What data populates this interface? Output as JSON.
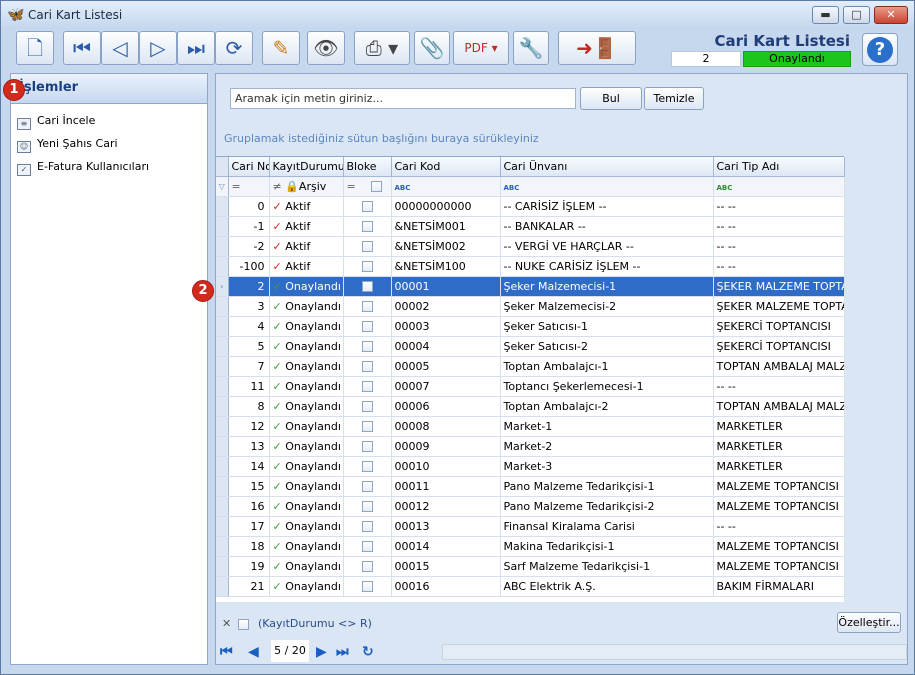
{
  "window": {
    "title": "Cari Kart Listesi",
    "min_label": "▬",
    "max_label": "□",
    "close_label": "✕"
  },
  "header": {
    "title": "Cari Kart Listesi",
    "record_no": "2",
    "status": "Onaylandı",
    "help_label": "?"
  },
  "toolbar": {
    "icons": [
      "new-doc-icon",
      "first-icon",
      "prev-icon",
      "next-icon",
      "last-icon",
      "refresh-icon",
      "edit-icon",
      "preview-icon",
      "print-icon",
      "attach-icon",
      "pdf-save-icon",
      "settings-icon",
      "exit-icon"
    ]
  },
  "left_panel": {
    "title": "İşlemler",
    "items": [
      {
        "label": "Cari İncele"
      },
      {
        "label": "Yeni Şahıs Cari"
      },
      {
        "label": "E-Fatura Kullanıcıları"
      }
    ]
  },
  "badges": {
    "one": "1",
    "two": "2"
  },
  "search": {
    "placeholder": "Aramak için metin giriniz...",
    "find_label": "Bul",
    "clear_label": "Temizle"
  },
  "group_hint": "Gruplamak istediğiniz sütun başlığını buraya sürükleyiniz",
  "grid": {
    "columns": [
      "Cari No",
      "KayıtDurumu",
      "Bloke",
      "Cari Kod",
      "Cari Ünvanı",
      "Cari Tip Adı"
    ],
    "filter": {
      "no": "=",
      "status_op": "≠",
      "status_val": "Arşiv",
      "bloke": "=",
      "kod": "ABC",
      "unvan": "ABC",
      "tip": "ABC"
    },
    "rows": [
      {
        "no": "0",
        "status": "Aktif",
        "kod": "00000000000",
        "unvan": "-- CARİSİZ İŞLEM --",
        "tip": "-- --",
        "active": true
      },
      {
        "no": "-1",
        "status": "Aktif",
        "kod": "&NETSİM001",
        "unvan": "-- BANKALAR --",
        "tip": "-- --",
        "active": true
      },
      {
        "no": "-2",
        "status": "Aktif",
        "kod": "&NETSİM002",
        "unvan": "-- VERGİ VE HARÇLAR --",
        "tip": "-- --",
        "active": true
      },
      {
        "no": "-100",
        "status": "Aktif",
        "kod": "&NETSİM100",
        "unvan": "-- NUKE CARİSİZ İŞLEM --",
        "tip": "-- --",
        "active": true
      },
      {
        "no": "2",
        "status": "Onaylandı",
        "kod": "00001",
        "unvan": "Şeker Malzemecisi-1",
        "tip": "ŞEKER MALZEME TOPTANCISI",
        "selected": true
      },
      {
        "no": "3",
        "status": "Onaylandı",
        "kod": "00002",
        "unvan": "Şeker Malzemecisi-2",
        "tip": "ŞEKER MALZEME TOPTANCISI"
      },
      {
        "no": "4",
        "status": "Onaylandı",
        "kod": "00003",
        "unvan": "Şeker Satıcısı-1",
        "tip": "ŞEKERCİ TOPTANCISI"
      },
      {
        "no": "5",
        "status": "Onaylandı",
        "kod": "00004",
        "unvan": "Şeker Satıcısı-2",
        "tip": "ŞEKERCİ TOPTANCISI"
      },
      {
        "no": "7",
        "status": "Onaylandı",
        "kod": "00005",
        "unvan": "Toptan Ambalajcı-1",
        "tip": "TOPTAN AMBALAJ MALZEMECİSİ"
      },
      {
        "no": "11",
        "status": "Onaylandı",
        "kod": "00007",
        "unvan": "Toptancı Şekerlemecesi-1",
        "tip": "-- --"
      },
      {
        "no": "8",
        "status": "Onaylandı",
        "kod": "00006",
        "unvan": "Toptan Ambalajcı-2",
        "tip": "TOPTAN AMBALAJ MALZEMECİSİ"
      },
      {
        "no": "12",
        "status": "Onaylandı",
        "kod": "00008",
        "unvan": "Market-1",
        "tip": "MARKETLER"
      },
      {
        "no": "13",
        "status": "Onaylandı",
        "kod": "00009",
        "unvan": "Market-2",
        "tip": "MARKETLER"
      },
      {
        "no": "14",
        "status": "Onaylandı",
        "kod": "00010",
        "unvan": "Market-3",
        "tip": "MARKETLER"
      },
      {
        "no": "15",
        "status": "Onaylandı",
        "kod": "00011",
        "unvan": "Pano Malzeme Tedarikçisi-1",
        "tip": "MALZEME TOPTANCISI"
      },
      {
        "no": "16",
        "status": "Onaylandı",
        "kod": "00012",
        "unvan": "Pano Malzeme Tedarikçisi-2",
        "tip": "MALZEME TOPTANCISI"
      },
      {
        "no": "17",
        "status": "Onaylandı",
        "kod": "00013",
        "unvan": "Finansal Kiralama Carisi",
        "tip": "-- --"
      },
      {
        "no": "18",
        "status": "Onaylandı",
        "kod": "00014",
        "unvan": "Makina Tedarikçisi-1",
        "tip": "MALZEME TOPTANCISI"
      },
      {
        "no": "19",
        "status": "Onaylandı",
        "kod": "00015",
        "unvan": "Sarf Malzeme Tedarikçisi-1",
        "tip": "MALZEME TOPTANCISI"
      },
      {
        "no": "21",
        "status": "Onaylandı",
        "kod": "00016",
        "unvan": "ABC Elektrik A.Ş.",
        "tip": "BAKIM FİRMALARI"
      }
    ]
  },
  "footer": {
    "filter_text": "(KayıtDurumu <> R)",
    "customize_label": "Özelleştir...",
    "page": "5 / 20"
  }
}
